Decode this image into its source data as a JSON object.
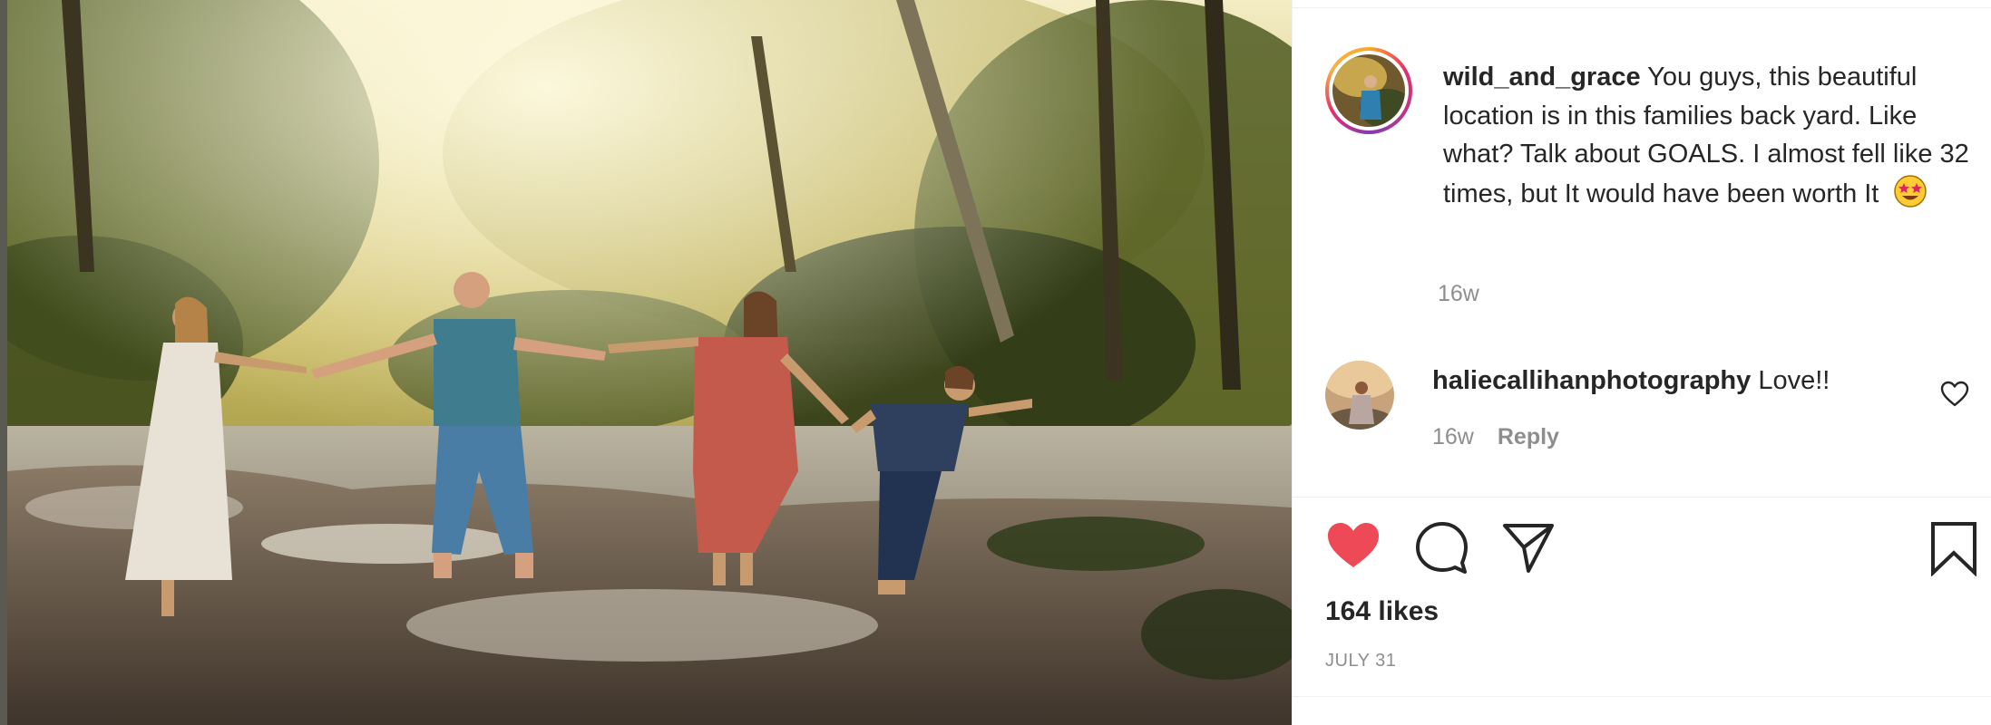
{
  "post": {
    "image_alt": "Family of four holding hands crossing a shallow rocky creek in a sunlit forest",
    "author": {
      "username": "wild_and_grace"
    },
    "caption": {
      "text": "You guys, this beautiful location is in this families back yard. Like what? Talk about GOALS. I almost fell like 32 times, but It would have been worth It",
      "emoji": "star-struck-emoji",
      "time": "16w"
    },
    "comments": [
      {
        "username": "haliecallihanphotography",
        "text": "Love!!",
        "time": "16w",
        "reply_label": "Reply"
      }
    ],
    "actions": {
      "like_icon": "heart-icon",
      "comment_icon": "comment-icon",
      "share_icon": "share-icon",
      "save_icon": "bookmark-icon",
      "like_color": "#ed4956"
    },
    "likes": "164 likes",
    "date": "JULY 31"
  }
}
